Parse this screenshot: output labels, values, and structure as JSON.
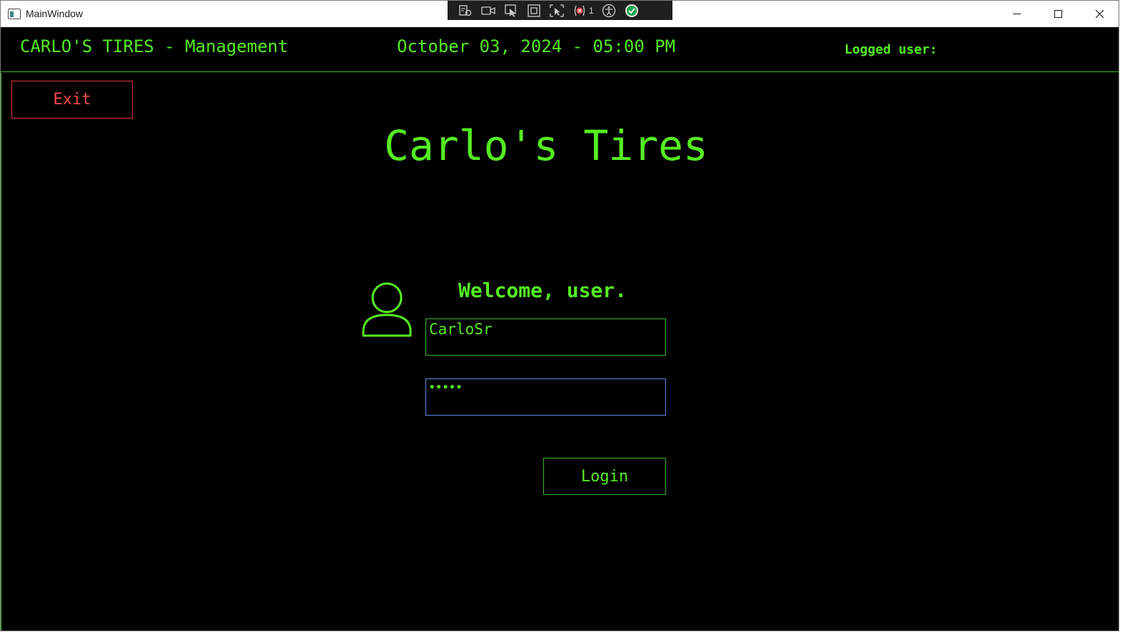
{
  "window": {
    "title": "MainWindow"
  },
  "debug_toolbar": {
    "binding_error_count": "1",
    "icons": [
      "live-visual-tree-icon",
      "record-icon",
      "select-element-icon",
      "display-layout-adorners-icon",
      "track-focus-icon",
      "binding-failures-icon",
      "accessibility-icon",
      "hot-reload-ok-icon"
    ]
  },
  "header": {
    "title": "CARLO'S TIRES - Management",
    "datetime": "October 03, 2024 - 05:00 PM",
    "logged_user_label": "Logged user:",
    "logged_user_value": ""
  },
  "main": {
    "exit_label": "Exit",
    "brand_title": "Carlo's Tires",
    "welcome": "Welcome, user.",
    "username_value": "CarloSr",
    "password_value": "•••••",
    "login_label": "Login",
    "avatar_icon": "user-icon"
  },
  "colors": {
    "accent": "#55ee22",
    "danger": "#ff4a4f",
    "focus": "#5b8be0",
    "background": "#000000"
  }
}
